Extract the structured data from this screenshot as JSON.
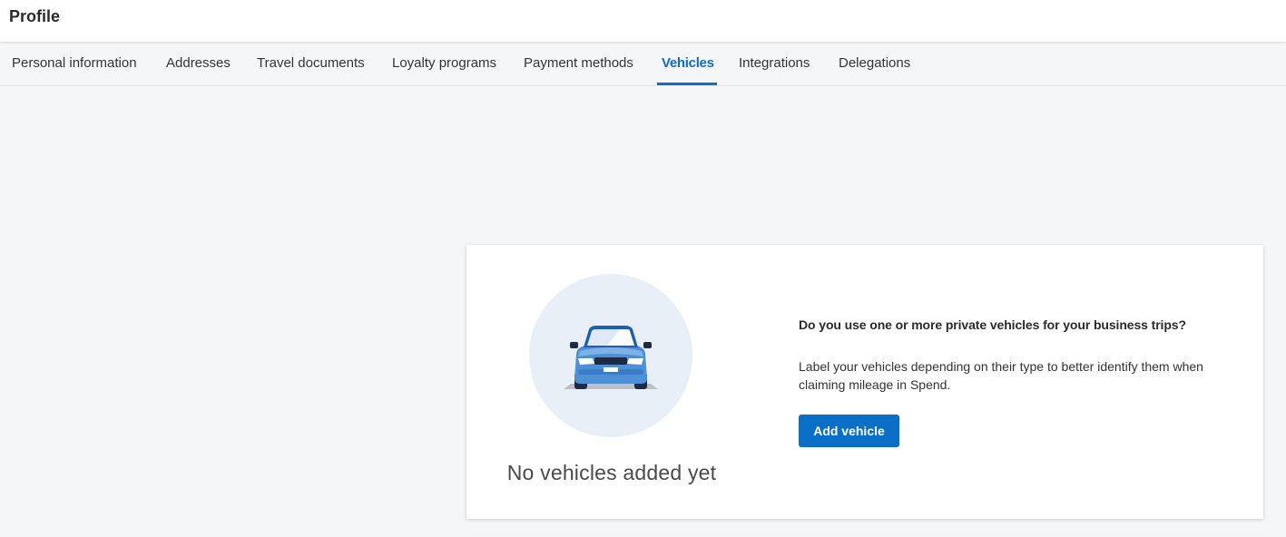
{
  "header": {
    "title": "Profile"
  },
  "tabs": [
    {
      "label": "Personal information",
      "active": false
    },
    {
      "label": "Addresses",
      "active": false
    },
    {
      "label": "Travel documents",
      "active": false
    },
    {
      "label": "Loyalty programs",
      "active": false
    },
    {
      "label": "Payment methods",
      "active": false
    },
    {
      "label": "Vehicles",
      "active": true
    },
    {
      "label": "Integrations",
      "active": false
    },
    {
      "label": "Delegations",
      "active": false
    }
  ],
  "empty_state": {
    "icon": "car-icon",
    "title": "No vehicles added yet",
    "question": "Do you use one or more private vehicles for your business trips?",
    "description": "Label your vehicles depending on their type to better identify them when claiming mileage in Spend.",
    "button_label": "Add vehicle"
  },
  "colors": {
    "accent": "#0b6fc7",
    "background": "#f5f6f8",
    "card": "#ffffff",
    "illustration_circle": "#e8eff7"
  }
}
